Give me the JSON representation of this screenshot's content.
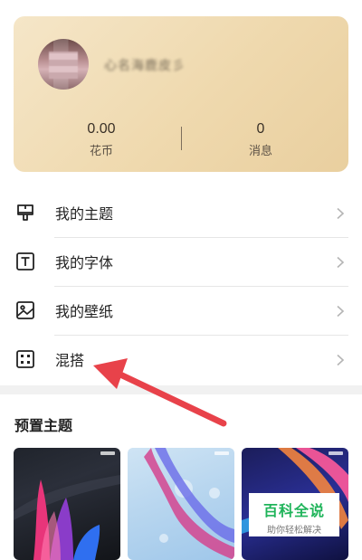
{
  "profile": {
    "username": "心名海鹿皮彡",
    "coins_value": "0.00",
    "coins_label": "花币",
    "messages_value": "0",
    "messages_label": "消息"
  },
  "menu": {
    "items": [
      {
        "label": "我的主题",
        "icon": "paint-brush-icon"
      },
      {
        "label": "我的字体",
        "icon": "font-icon"
      },
      {
        "label": "我的壁纸",
        "icon": "image-icon"
      },
      {
        "label": "混搭",
        "icon": "mix-dice-icon"
      }
    ]
  },
  "preset_section": {
    "title": "预置主题",
    "themes": [
      {
        "name": "theme-dark-ribbon"
      },
      {
        "name": "theme-light-ribbon"
      },
      {
        "name": "theme-blue-ribbon"
      }
    ]
  },
  "watermark": {
    "title": "百科全说",
    "subtitle": "助你轻松解决"
  },
  "colors": {
    "card_gradient_start": "#f5e6c8",
    "card_gradient_end": "#e9cf9f",
    "arrow": "#e8424a",
    "watermark_green": "#1fb45a"
  }
}
